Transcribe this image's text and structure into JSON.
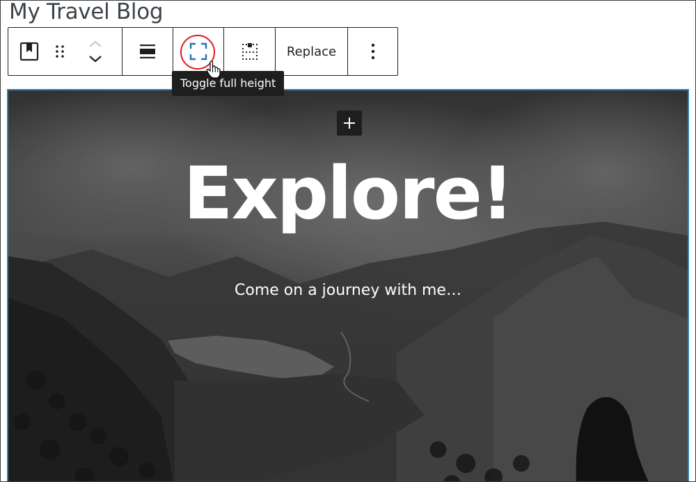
{
  "post": {
    "title": "My Travel Blog"
  },
  "toolbar": {
    "block_type_icon": "cover-block-icon",
    "drag_handle_icon": "drag-handle-icon",
    "move_up_icon": "chevron-up-icon",
    "move_down_icon": "chevron-down-icon",
    "align_icon": "align-center-icon",
    "full_height_icon": "fullscreen-icon",
    "content_position_icon": "content-position-icon",
    "replace_label": "Replace",
    "more_options_icon": "vertical-ellipsis-icon"
  },
  "tooltip": {
    "text": "Toggle full height"
  },
  "cover": {
    "heading": "Explore!",
    "subheading": "Come on a journey with me…"
  },
  "colors": {
    "accent_border": "#2f7fb6",
    "icon_blue": "#2271b1",
    "highlight_ring": "#e0191f",
    "toolbar_text": "#1e1e1e"
  }
}
